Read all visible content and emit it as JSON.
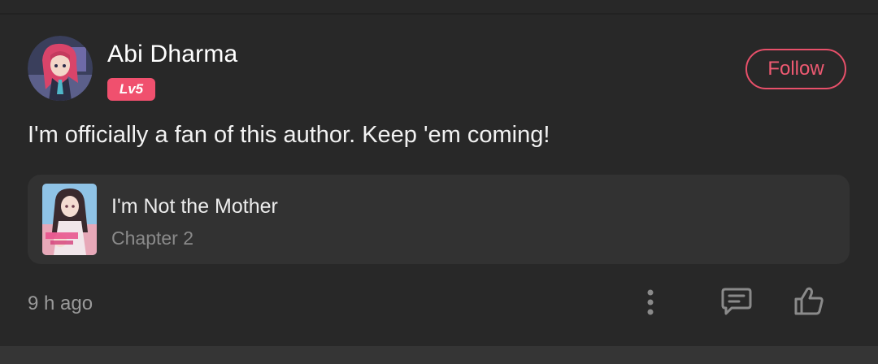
{
  "comment": {
    "user": {
      "name": "Abi Dharma",
      "level": "Lv5",
      "avatar_icon": "anime-avatar"
    },
    "follow_label": "Follow",
    "text": "I'm officially a fan of this author. Keep 'em coming!",
    "book": {
      "title": "I'm Not the Mother",
      "chapter": "Chapter 2",
      "cover_icon": "book-cover"
    },
    "time": "9 h ago",
    "actions": {
      "more_icon": "more-vertical-icon",
      "reply_icon": "comment-icon",
      "like_icon": "thumbs-up-icon"
    }
  },
  "colors": {
    "background": "#282828",
    "card": "#323232",
    "accent": "#e8506a",
    "badge": "#f0506e",
    "text_primary": "#ffffff",
    "text_secondary": "#9a9a9a"
  }
}
